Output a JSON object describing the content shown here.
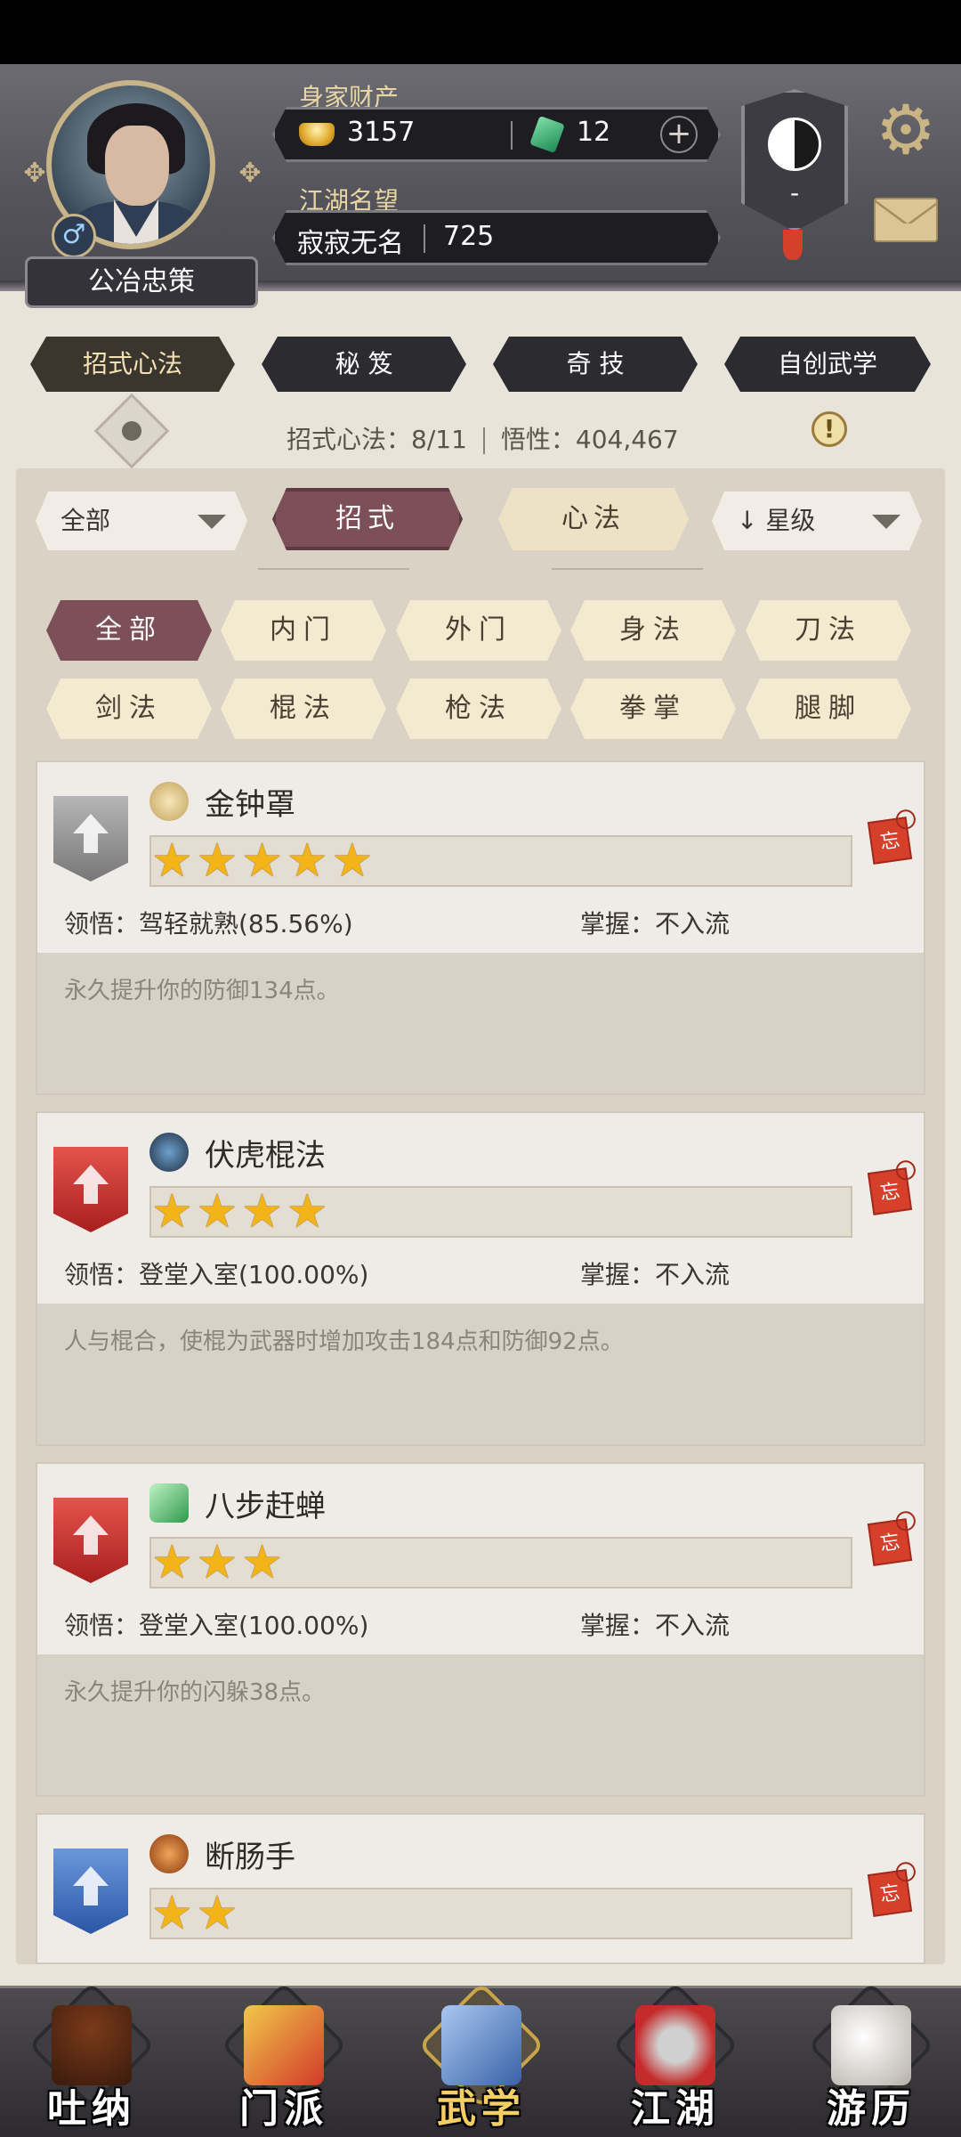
{
  "player": {
    "name": "公冶忠策",
    "gender_symbol": "♂",
    "wealth_label": "身家财产",
    "silver": "3157",
    "jade": "12",
    "plus": "+",
    "reputation_label": "江湖名望",
    "reputation_title": "寂寂无名",
    "reputation_value": "725",
    "sect_emblem_value": "-"
  },
  "top_tabs": [
    {
      "label": "招式心法",
      "active": true
    },
    {
      "label": "秘 笈",
      "active": false
    },
    {
      "label": "奇 技",
      "active": false
    },
    {
      "label": "自创武学",
      "active": false
    }
  ],
  "summary": {
    "count": "招式心法：8/11",
    "insight": "悟性：404,467",
    "alert": "!"
  },
  "filters": {
    "category_dropdown": "全部",
    "type_on": "招式",
    "type_off": "心法",
    "sort_dropdown": "星级",
    "sort_arrow": "↓"
  },
  "chips": [
    {
      "label": "全部",
      "active": true
    },
    {
      "label": "内门",
      "active": false
    },
    {
      "label": "外门",
      "active": false
    },
    {
      "label": "身法",
      "active": false
    },
    {
      "label": "刀法",
      "active": false
    },
    {
      "label": "剑法",
      "active": false
    },
    {
      "label": "棍法",
      "active": false
    },
    {
      "label": "枪法",
      "active": false
    },
    {
      "label": "拳掌",
      "active": false
    },
    {
      "label": "腿脚",
      "active": false
    }
  ],
  "skills": [
    {
      "name": "金钟罩",
      "stars": "★★★★★",
      "star_count": 5,
      "banner": "gray",
      "lingwu": "领悟：驾轻就熟(85.56%)",
      "zhangwo": "掌握：不入流",
      "desc": "永久提升你的防御134点。",
      "forget": "忘"
    },
    {
      "name": "伏虎棍法",
      "stars": "★★★★",
      "star_count": 4,
      "banner": "red",
      "lingwu": "领悟：登堂入室(100.00%)",
      "zhangwo": "掌握：不入流",
      "desc": "人与棍合，使棍为武器时增加攻击184点和防御92点。",
      "forget": "忘"
    },
    {
      "name": "八步赶蝉",
      "stars": "★★★",
      "star_count": 3,
      "banner": "red",
      "lingwu": "领悟：登堂入室(100.00%)",
      "zhangwo": "掌握：不入流",
      "desc": "永久提升你的闪躲38点。",
      "forget": "忘"
    },
    {
      "name": "断肠手",
      "stars": "★★",
      "star_count": 2,
      "banner": "blue",
      "forget": "忘"
    }
  ],
  "bottom_nav": [
    {
      "label": "吐纳",
      "active": false
    },
    {
      "label": "门派",
      "active": false
    },
    {
      "label": "武学",
      "active": true
    },
    {
      "label": "江湖",
      "active": false
    },
    {
      "label": "游历",
      "active": false
    }
  ],
  "colors": {
    "accent": "#7d4f58",
    "gold_star": "#f2b419",
    "forget_seal": "#d6402b"
  }
}
